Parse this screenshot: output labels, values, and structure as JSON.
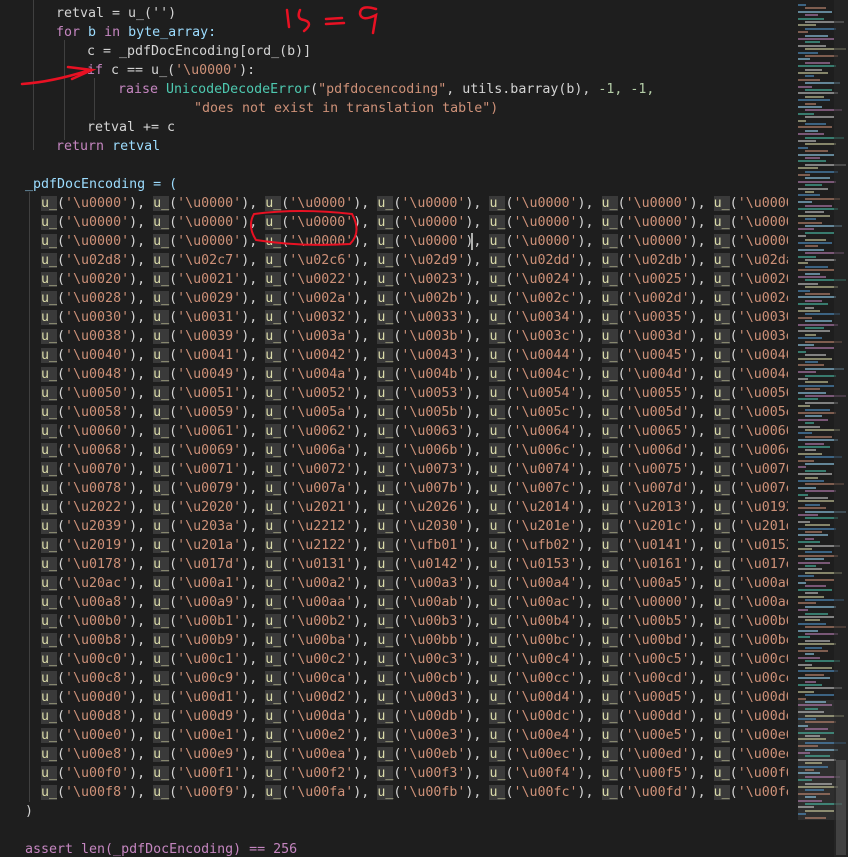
{
  "editor": {
    "code": {
      "retval_init": "retval = u_('')",
      "for_kw": "for",
      "for_var": "b",
      "in_kw": "in",
      "for_iter": "byte_array:",
      "assign_c": "c = _pdfDocEncoding[ord_(b)]",
      "if_kw": "if",
      "if_cond_a": "c == u_(",
      "if_cond_str": "'\\u0000'",
      "if_cond_b": "):",
      "raise_kw": "raise",
      "raise_cls": "UnicodeDecodeError",
      "raise_open": "(",
      "raise_str": "\"pdfdocencoding\"",
      "raise_mid": ", utils.barray(b), ",
      "raise_nums": "-1, -1,",
      "raise_msg": "\"does not exist in translation table\")",
      "retval_add": "retval += c",
      "return_kw": "return",
      "return_var": "retval",
      "enc_decl": "_pdfDocEncoding = (",
      "close_paren": ")",
      "assert_line": "assert len(_pdfDocEncoding) == 256"
    },
    "table_rows": [
      [
        "0000",
        "0000",
        "0000",
        "0000",
        "0000",
        "0000",
        "0000",
        "0000"
      ],
      [
        "0000",
        "0000",
        "0000",
        "0000",
        "0000",
        "0000",
        "0000",
        "0000"
      ],
      [
        "0000",
        "0000",
        "0000",
        "0000",
        "0000",
        "0000",
        "0000",
        "0000"
      ],
      [
        "02d8",
        "02c7",
        "02c6",
        "02d9",
        "02dd",
        "02db",
        "02da",
        "02dc"
      ],
      [
        "0020",
        "0021",
        "0022",
        "0023",
        "0024",
        "0025",
        "0026",
        "0027"
      ],
      [
        "0028",
        "0029",
        "002a",
        "002b",
        "002c",
        "002d",
        "002e",
        "002f"
      ],
      [
        "0030",
        "0031",
        "0032",
        "0033",
        "0034",
        "0035",
        "0036",
        "0037"
      ],
      [
        "0038",
        "0039",
        "003a",
        "003b",
        "003c",
        "003d",
        "003e",
        "003f"
      ],
      [
        "0040",
        "0041",
        "0042",
        "0043",
        "0044",
        "0045",
        "0046",
        "0047"
      ],
      [
        "0048",
        "0049",
        "004a",
        "004b",
        "004c",
        "004d",
        "004e",
        "004f"
      ],
      [
        "0050",
        "0051",
        "0052",
        "0053",
        "0054",
        "0055",
        "0056",
        "0057"
      ],
      [
        "0058",
        "0059",
        "005a",
        "005b",
        "005c",
        "005d",
        "005e",
        "005f"
      ],
      [
        "0060",
        "0061",
        "0062",
        "0063",
        "0064",
        "0065",
        "0066",
        "0067"
      ],
      [
        "0068",
        "0069",
        "006a",
        "006b",
        "006c",
        "006d",
        "006e",
        "006f"
      ],
      [
        "0070",
        "0071",
        "0072",
        "0073",
        "0074",
        "0075",
        "0076",
        "0077"
      ],
      [
        "0078",
        "0079",
        "007a",
        "007b",
        "007c",
        "007d",
        "007e",
        "0000"
      ],
      [
        "2022",
        "2020",
        "2021",
        "2026",
        "2014",
        "2013",
        "0192",
        "2044"
      ],
      [
        "2039",
        "203a",
        "2212",
        "2030",
        "201e",
        "201c",
        "201d",
        "2018"
      ],
      [
        "2019",
        "201a",
        "2122",
        "fb01",
        "fb02",
        "0141",
        "0152",
        "0160"
      ],
      [
        "0178",
        "017d",
        "0131",
        "0142",
        "0153",
        "0161",
        "017e",
        "0000"
      ],
      [
        "20ac",
        "00a1",
        "00a2",
        "00a3",
        "00a4",
        "00a5",
        "00a6",
        "00a7"
      ],
      [
        "00a8",
        "00a9",
        "00aa",
        "00ab",
        "00ac",
        "0000",
        "00ae",
        "00af"
      ],
      [
        "00b0",
        "00b1",
        "00b2",
        "00b3",
        "00b4",
        "00b5",
        "00b6",
        "00b7"
      ],
      [
        "00b8",
        "00b9",
        "00ba",
        "00bb",
        "00bc",
        "00bd",
        "00be",
        "00bf"
      ],
      [
        "00c0",
        "00c1",
        "00c2",
        "00c3",
        "00c4",
        "00c5",
        "00c6",
        "00c7"
      ],
      [
        "00c8",
        "00c9",
        "00ca",
        "00cb",
        "00cc",
        "00cd",
        "00ce",
        "00cf"
      ],
      [
        "00d0",
        "00d1",
        "00d2",
        "00d3",
        "00d4",
        "00d5",
        "00d6",
        "00d7"
      ],
      [
        "00d8",
        "00d9",
        "00da",
        "00db",
        "00dc",
        "00dd",
        "00de",
        "00df"
      ],
      [
        "00e0",
        "00e1",
        "00e2",
        "00e3",
        "00e4",
        "00e5",
        "00e6",
        "00e7"
      ],
      [
        "00e8",
        "00e9",
        "00ea",
        "00eb",
        "00ec",
        "00ed",
        "00ee",
        "00ef"
      ],
      [
        "00f0",
        "00f1",
        "00f2",
        "00f3",
        "00f4",
        "00f5",
        "00f6",
        "00f7"
      ],
      [
        "00f8",
        "00f9",
        "00fa",
        "00fb",
        "00fc",
        "00fd",
        "00fe",
        "00ff"
      ]
    ],
    "handwritten_note": "1<=9"
  },
  "colors": {
    "background": "#1e1e1e",
    "keyword": "#569cd6",
    "control": "#c586c0",
    "function": "#dcdcaa",
    "string": "#ce9178",
    "number": "#b5cea8",
    "variable": "#9cdcfe",
    "class": "#4ec9b0",
    "annotation_ink": "#e81123"
  }
}
